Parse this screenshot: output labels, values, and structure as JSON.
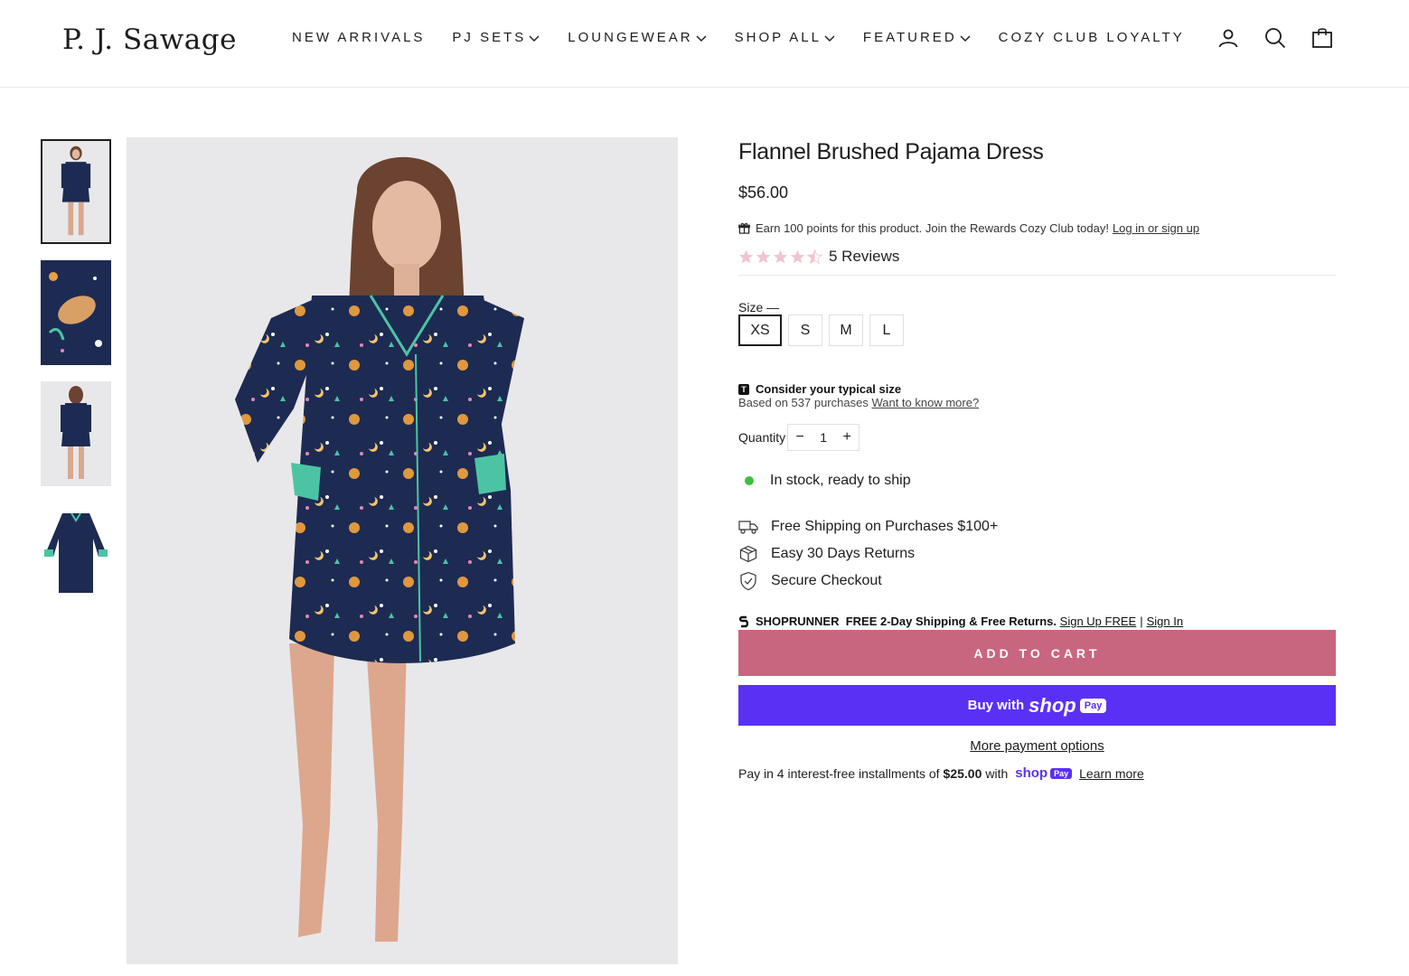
{
  "brand": {
    "name": "P. J. Sawage"
  },
  "nav": {
    "items": [
      {
        "label": "NEW ARRIVALS",
        "dropdown": false
      },
      {
        "label": "PJ SETS",
        "dropdown": true
      },
      {
        "label": "LOUNGEWEAR",
        "dropdown": true
      },
      {
        "label": "SHOP ALL",
        "dropdown": true
      },
      {
        "label": "FEATURED",
        "dropdown": true
      },
      {
        "label": "COZY CLUB LOYALTY",
        "dropdown": false
      }
    ]
  },
  "header_icons": [
    "account-icon",
    "search-icon",
    "cart-icon"
  ],
  "product": {
    "title": "Flannel Brushed Pajama Dress",
    "price": "$56.00",
    "rewards": {
      "text": "Earn 100 points for this product. Join the Rewards Cozy Club today!",
      "link": "Log in or sign up"
    },
    "rating": {
      "stars": 4.5,
      "max": 5,
      "reviews_label": "5 Reviews"
    },
    "size": {
      "label": "Size",
      "options": [
        "XS",
        "S",
        "M",
        "L"
      ],
      "selected": "XS"
    },
    "fit": {
      "badge": "T",
      "heading": "Consider your typical size",
      "sub": "Based on 537 purchases",
      "link": "Want to know more?"
    },
    "quantity": {
      "label": "Quantity",
      "value": "1",
      "minus": "−",
      "plus": "+"
    },
    "stock": "In stock, ready to ship",
    "perks": [
      {
        "icon": "truck-icon",
        "text": "Free Shipping on Purchases $100+"
      },
      {
        "icon": "box-icon",
        "text": "Easy 30 Days Returns"
      },
      {
        "icon": "shield-check-icon",
        "text": "Secure Checkout"
      }
    ],
    "shoprunner": {
      "brand": "SHOPRUNNER",
      "text": "FREE 2-Day Shipping & Free Returns.",
      "signup": "Sign Up FREE",
      "sep": "|",
      "signin": "Sign In"
    },
    "add_to_cart": "ADD TO CART",
    "shop_pay": {
      "buy": "Buy with",
      "shop": "shop",
      "pay": "Pay"
    },
    "more_options": "More payment options",
    "installments": {
      "prefix": "Pay in 4 interest-free installments of",
      "amount": "$25.00",
      "with": "with",
      "shop": "shop",
      "pay": "Pay",
      "link": "Learn more"
    }
  },
  "colors": {
    "accent": "#c9667f",
    "shop_pay": "#5a31f4",
    "in_stock": "#3dbf3d",
    "dress_navy": "#1d2b52",
    "cuff_teal": "#4cc4a4",
    "star": "#f2c4cf"
  }
}
